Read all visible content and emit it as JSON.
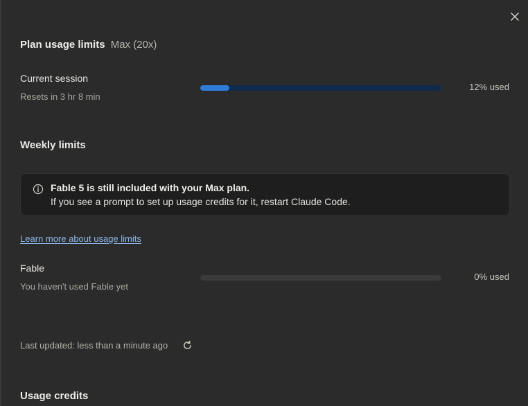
{
  "close_label": "close",
  "plan": {
    "title": "Plan usage limits",
    "badge": "Max (20x)"
  },
  "current_session": {
    "label": "Current session",
    "subtext": "Resets in 3 hr 8 min",
    "percent_used": 12,
    "used_text": "12% used",
    "fill_color": "#2f7bd6",
    "track_color": "#0f2a4d"
  },
  "weekly": {
    "title": "Weekly limits"
  },
  "notice": {
    "icon": "info-icon",
    "title": "Fable 5 is still included with your Max plan.",
    "body": "If you see a prompt to set up usage credits for it, restart Claude Code."
  },
  "learn_more_link": "Learn more about usage limits",
  "fable": {
    "label": "Fable",
    "subtext": "You haven't used Fable yet",
    "percent_used": 0,
    "used_text": "0% used",
    "track_color": "#3a3a3a"
  },
  "last_updated": "Last updated: less than a minute ago",
  "refresh_icon": "refresh-icon",
  "usage_credits": {
    "title": "Usage credits"
  }
}
